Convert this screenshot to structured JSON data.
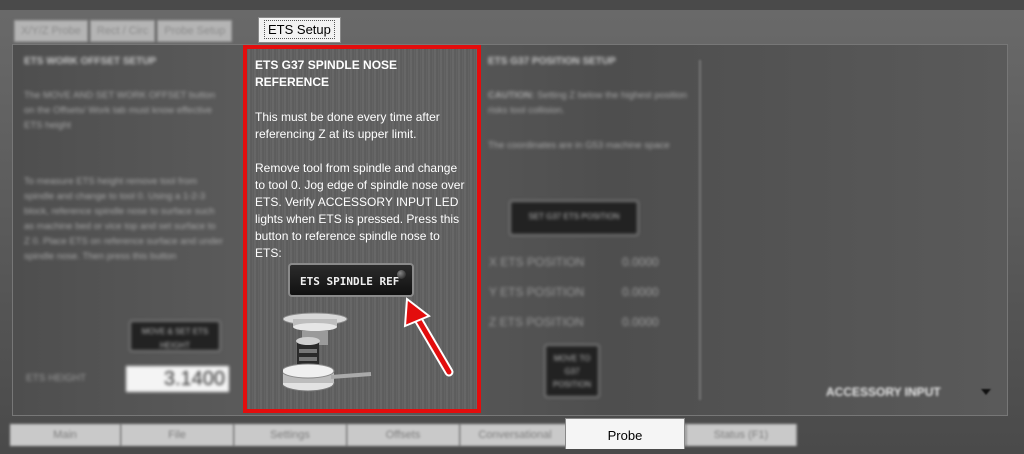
{
  "sub_tabs": [
    "X/Y/Z Probe",
    "Rect / Circ",
    "Probe Setup"
  ],
  "active_sub_tab": "ETS Setup",
  "left_panel": {
    "title": "ETS WORK OFFSET SETUP",
    "text1": "The MOVE AND SET WORK OFFSET button on the Offsets/ Work tab must know effective ETS height",
    "text2": "To measure ETS height remove tool from spindle and change to tool 0. Using a 1-2-3 block, reference spindle nose to surface such as machine bed or vice top and set surface to Z 0. Place ETS on reference surface and under spindle nose. Then press this button",
    "button": "MOVE & SET ETS HEIGHT",
    "height_label": "ETS HEIGHT",
    "height_value": "3.1400"
  },
  "center_panel": {
    "title": "ETS G37 SPINDLE NOSE REFERENCE",
    "p1": "This must be done every time after referencing Z at its upper limit.",
    "p2": "Remove tool from spindle and change to tool 0. Jog edge of spindle nose over ETS. Verify ACCESSORY INPUT LED lights when ETS is pressed. Press this button to reference spindle nose to ETS:",
    "button": "ETS SPINDLE REF"
  },
  "right_panel": {
    "title": "ETS G37 POSITION SETUP",
    "caution_bold": "CAUTION:",
    "caution_text": "Setting Z below the highest position risks tool collision.",
    "coords_text": "The coordinates are in G53 machine space",
    "set_button": "SET G37 ETS POSITION",
    "rows": [
      {
        "label": "X ETS POSITION",
        "value": "0.0000"
      },
      {
        "label": "Y ETS POSITION",
        "value": "0.0000"
      },
      {
        "label": "Z ETS POSITION",
        "value": "0.0000"
      }
    ],
    "move_button": "MOVE TO G37 POSITION"
  },
  "accessory_input": "ACCESSORY INPUT",
  "bottom_tabs": [
    "Main",
    "File",
    "Settings",
    "Offsets",
    "Conversational",
    "Probe",
    "Status (F1)"
  ],
  "active_bottom_tab": "Probe",
  "colors": {
    "highlight": "#e30d0d",
    "arrow": "#e30d0d"
  }
}
